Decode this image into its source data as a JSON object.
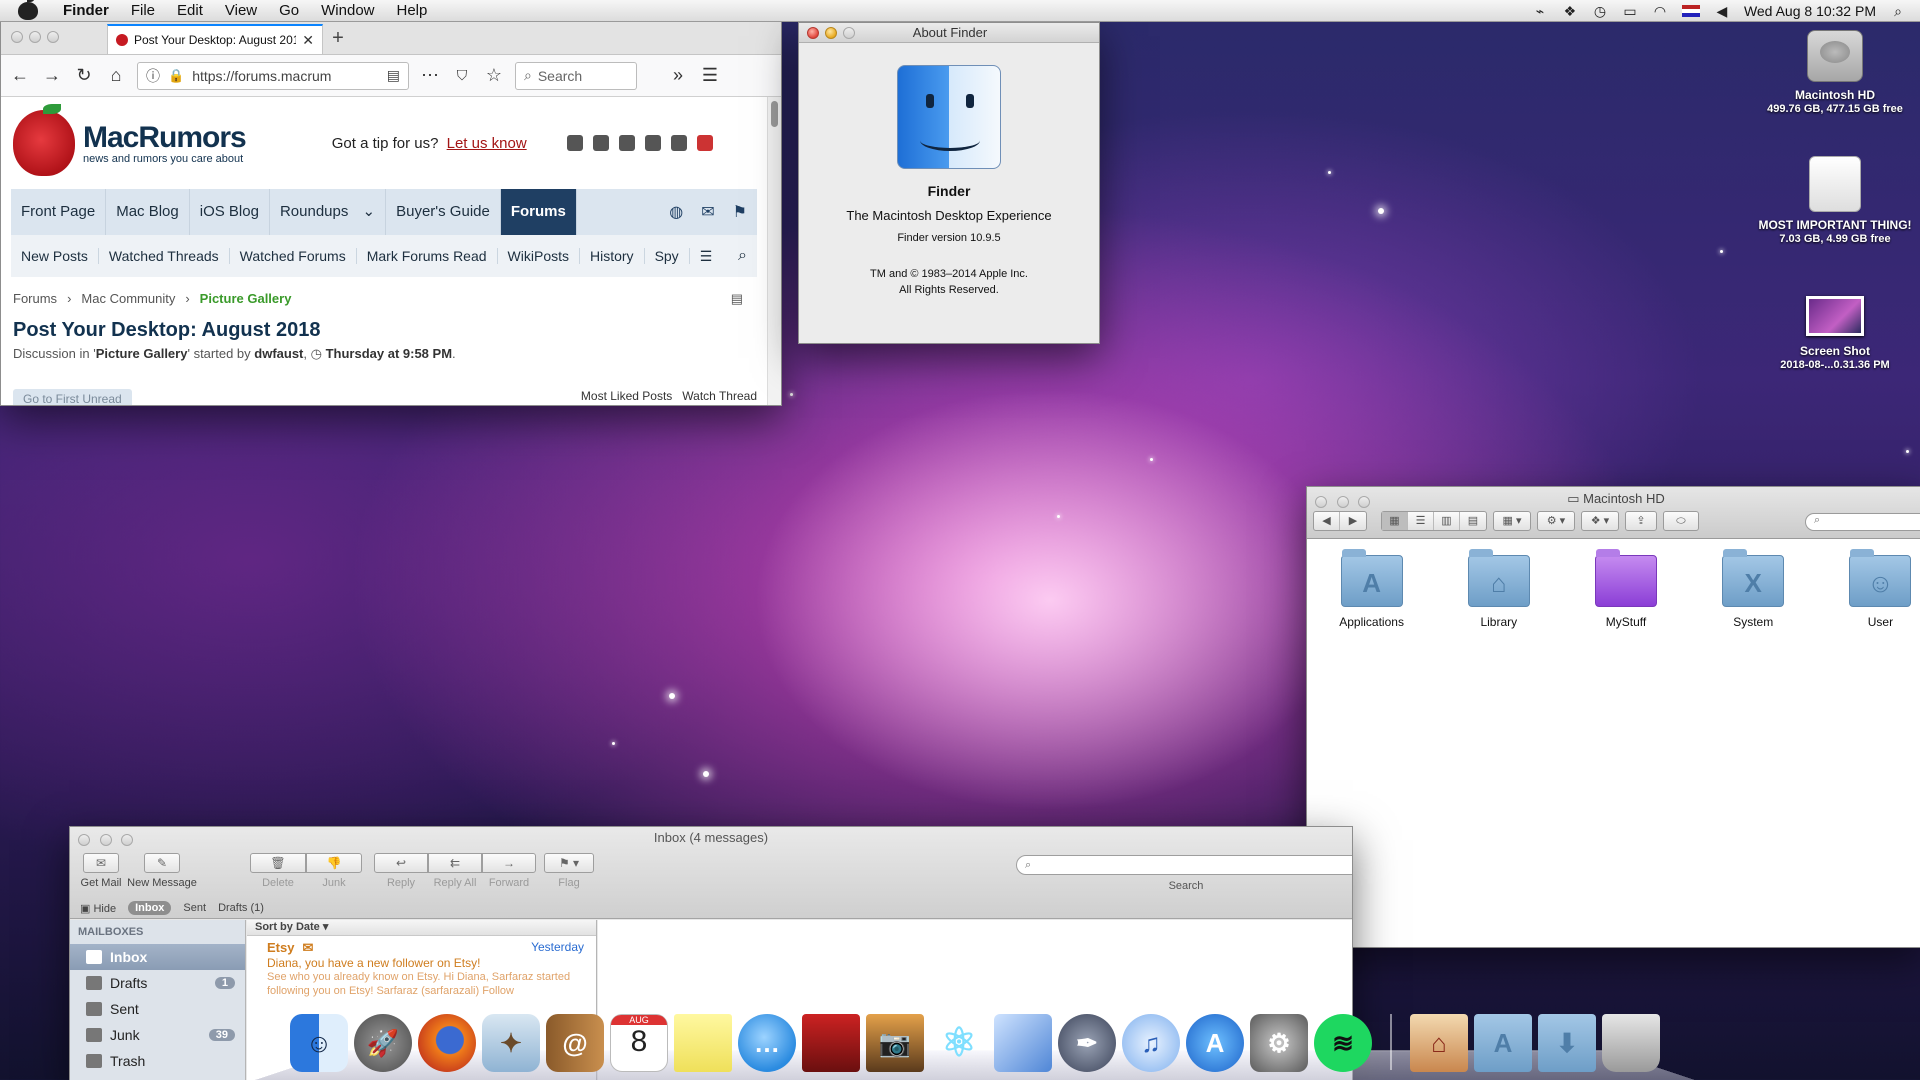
{
  "menubar": {
    "app_name": "Finder",
    "menus": [
      "File",
      "Edit",
      "View",
      "Go",
      "Window",
      "Help"
    ],
    "clock": "Wed Aug 8  10:32 PM",
    "status_icons": [
      "remote-icon",
      "dropbox-icon",
      "time-machine-icon",
      "airplay-icon",
      "wifi-icon",
      "flag-icon",
      "volume-icon",
      "spotlight-icon"
    ]
  },
  "firefox": {
    "tab_title": "Post Your Desktop: August 201",
    "url": "https://forums.macrum",
    "search_placeholder": "Search",
    "site": {
      "brand": "MacRumors",
      "tagline": "news and rumors you care about",
      "tip_text": "Got a tip for us?",
      "tip_link": "Let us know",
      "nav": [
        "Front Page",
        "Mac Blog",
        "iOS Blog",
        "Roundups",
        "Buyer's Guide",
        "Forums"
      ],
      "nav_active": "Forums",
      "roundups_chevron": "⌄",
      "subnav": [
        "New Posts",
        "Watched Threads",
        "Watched Forums",
        "Mark Forums Read",
        "WikiPosts",
        "History",
        "Spy"
      ],
      "breadcrumb": [
        "Forums",
        "Mac Community",
        "Picture Gallery"
      ],
      "thread_title": "Post Your Desktop: August 2018",
      "meta_prefix": "Discussion in '",
      "meta_forum": "Picture Gallery",
      "meta_mid": "' started by ",
      "meta_user": "dwfaust",
      "meta_time_prefix": ", ",
      "meta_time": "Thursday at 9:58 PM",
      "meta_end": ".",
      "first_unread": "Go to First Unread",
      "most_liked": "Most Liked Posts",
      "watch": "Watch Thread"
    }
  },
  "about_finder": {
    "window_title": "About Finder",
    "name": "Finder",
    "description": "The Macintosh Desktop Experience",
    "version": "Finder version 10.9.5",
    "copyright_1": "TM and © 1983–2014 Apple Inc.",
    "copyright_2": "All Rights Reserved."
  },
  "desktop_icons": [
    {
      "name": "Macintosh HD",
      "info": "499.76 GB, 477.15 GB free"
    },
    {
      "name": "MOST IMPORTANT THING!",
      "info": "7.03 GB, 4.99 GB free"
    },
    {
      "name": "Screen Shot",
      "info": "2018-08-...0.31.36 PM"
    }
  ],
  "finder_window": {
    "title": "Macintosh HD",
    "items": [
      "Applications",
      "Library",
      "MyStuff",
      "System",
      "User"
    ]
  },
  "mail": {
    "window_title": "Inbox (4 messages)",
    "toolbar": {
      "get_mail": "Get Mail",
      "new_message": "New Message",
      "delete": "Delete",
      "junk": "Junk",
      "reply": "Reply",
      "reply_all": "Reply All",
      "forward": "Forward",
      "flag": "Flag",
      "search": "Search"
    },
    "favorites": {
      "hide": "Hide",
      "inbox": "Inbox",
      "sent": "Sent",
      "drafts": "Drafts (1)"
    },
    "mailboxes_header": "MAILBOXES",
    "mailboxes": [
      {
        "label": "Inbox",
        "count": ""
      },
      {
        "label": "Drafts",
        "count": "1"
      },
      {
        "label": "Sent",
        "count": ""
      },
      {
        "label": "Junk",
        "count": "39"
      },
      {
        "label": "Trash",
        "count": ""
      }
    ],
    "sort_label": "Sort by Date ▾",
    "message": {
      "from": "Etsy",
      "date": "Yesterday",
      "subject": "Diana, you have a new follower on Etsy!",
      "preview": "See who you already know on Etsy. Hi Diana, Sarfaraz started following you on Etsy! Sarfaraz (sarfarazali) Follow"
    }
  },
  "dock": {
    "apps": [
      "finder-icon",
      "launchpad-icon",
      "firefox-icon",
      "preview-icon",
      "contacts-icon",
      "calendar-icon",
      "stickies-icon",
      "messages-icon",
      "photo-booth-icon",
      "iphoto-icon",
      "atom-icon",
      "virtualbox-icon",
      "script-editor-icon",
      "itunes-icon",
      "app-store-icon",
      "system-preferences-icon",
      "spotify-icon"
    ],
    "calendar_day": "8",
    "calendar_month": "AUG",
    "stacks": [
      "home-folder-icon",
      "applications-folder-icon",
      "downloads-folder-icon",
      "trash-icon"
    ]
  }
}
